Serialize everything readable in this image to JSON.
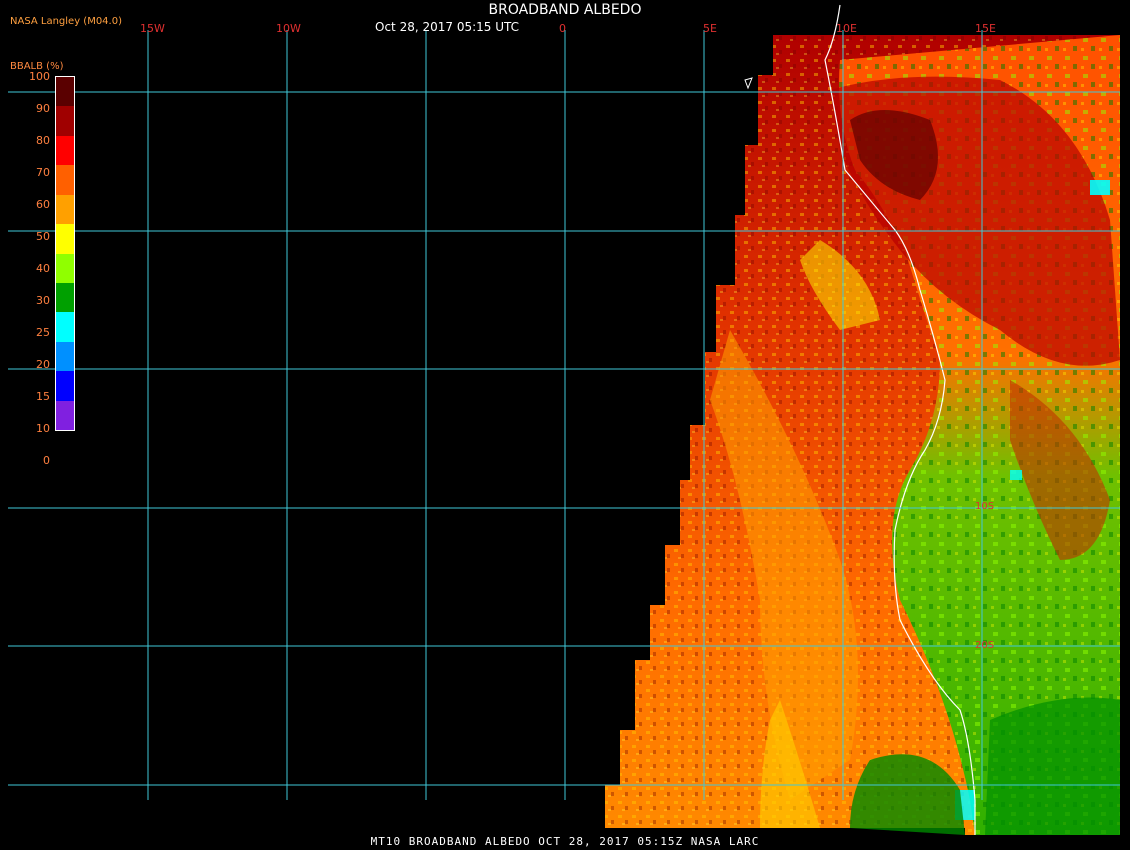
{
  "header": {
    "title": "BROADBAND ALBEDO",
    "datetime": "Oct 28, 2017 05:15 UTC",
    "org": "NASA Langley (M04.0)"
  },
  "legend": {
    "title": "BBALB (%)",
    "ticks": [
      "100",
      "90",
      "80",
      "70",
      "60",
      "50",
      "40",
      "30",
      "25",
      "20",
      "15",
      "10",
      "0"
    ],
    "colors": [
      "#5a0000",
      "#a00000",
      "#ff0000",
      "#ff6000",
      "#ffa000",
      "#ffff00",
      "#90ff00",
      "#00a000",
      "#00ffff",
      "#0090ff",
      "#0000ff",
      "#8020e0"
    ]
  },
  "graticule": {
    "lon_labels": [
      "15W",
      "10W",
      "0",
      "5E",
      "10E",
      "15E"
    ],
    "lat_labels": [
      "10S",
      "20S"
    ]
  },
  "footer": {
    "text": "MT10  BROADBAND ALBEDO   OCT 28, 2017 05:15Z   NASA LARC"
  },
  "colors": {
    "grid": "#40c8d8",
    "coast": "#ffffff",
    "accent": "#ff8040"
  }
}
